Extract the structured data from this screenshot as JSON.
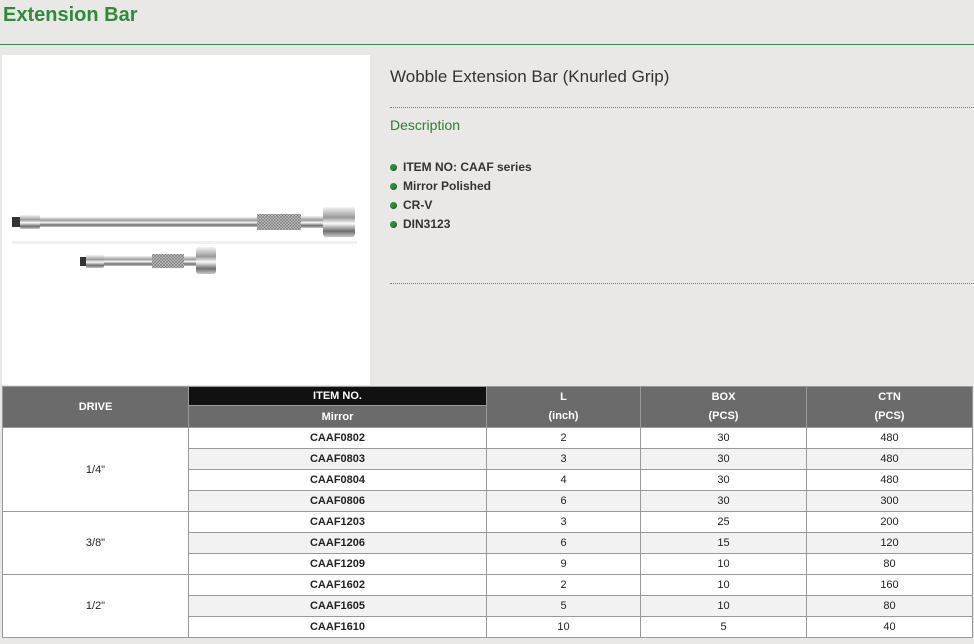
{
  "page": {
    "title": "Extension Bar"
  },
  "product": {
    "name": "Wobble Extension Bar (Knurled Grip)",
    "description_heading": "Description",
    "features": [
      "ITEM NO: CAAF series",
      "Mirror Polished",
      "CR-V",
      "DIN3123"
    ]
  },
  "table": {
    "headers": {
      "drive": "DRIVE",
      "item_no": "ITEM NO.",
      "finish": "Mirror",
      "l": "L",
      "l_unit": "(inch)",
      "box": "BOX",
      "box_unit": "(PCS)",
      "ctn": "CTN",
      "ctn_unit": "(PCS)"
    },
    "groups": [
      {
        "drive": "1/4\"",
        "rows": [
          {
            "item": "CAAF0802",
            "l": "2",
            "box": "30",
            "ctn": "480"
          },
          {
            "item": "CAAF0803",
            "l": "3",
            "box": "30",
            "ctn": "480"
          },
          {
            "item": "CAAF0804",
            "l": "4",
            "box": "30",
            "ctn": "480"
          },
          {
            "item": "CAAF0806",
            "l": "6",
            "box": "30",
            "ctn": "300"
          }
        ]
      },
      {
        "drive": "3/8\"",
        "rows": [
          {
            "item": "CAAF1203",
            "l": "3",
            "box": "25",
            "ctn": "200"
          },
          {
            "item": "CAAF1206",
            "l": "6",
            "box": "15",
            "ctn": "120"
          },
          {
            "item": "CAAF1209",
            "l": "9",
            "box": "10",
            "ctn": "80"
          }
        ]
      },
      {
        "drive": "1/2\"",
        "rows": [
          {
            "item": "CAAF1602",
            "l": "2",
            "box": "10",
            "ctn": "160"
          },
          {
            "item": "CAAF1605",
            "l": "5",
            "box": "10",
            "ctn": "80"
          },
          {
            "item": "CAAF1610",
            "l": "10",
            "box": "5",
            "ctn": "40"
          }
        ]
      }
    ]
  }
}
